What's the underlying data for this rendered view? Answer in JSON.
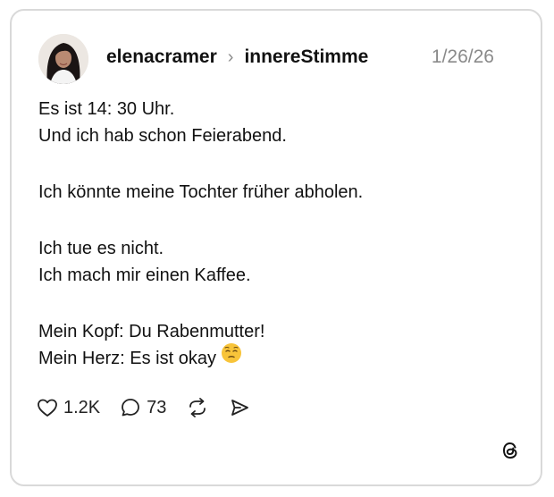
{
  "post": {
    "author": "elenacramer",
    "reply_to": "innereStimme",
    "timestamp": "1/26/26",
    "lines": [
      "Es ist 14: 30 Uhr.",
      "Und ich hab schon Feierabend.",
      "Ich könnte meine Tochter früher abholen.",
      "Ich tue es nicht.",
      "Ich mach mir einen Kaffee.",
      "Mein Kopf: Du Rabenmutter!",
      "Mein Herz: Es ist okay"
    ],
    "emoji_icon": "relieved-face-emoji",
    "likes": "1.2K",
    "replies": "73"
  },
  "icons": {
    "like": "heart-icon",
    "reply": "comment-bubble-icon",
    "repost": "repost-icon",
    "share": "send-icon",
    "brand": "threads-logo-icon"
  }
}
